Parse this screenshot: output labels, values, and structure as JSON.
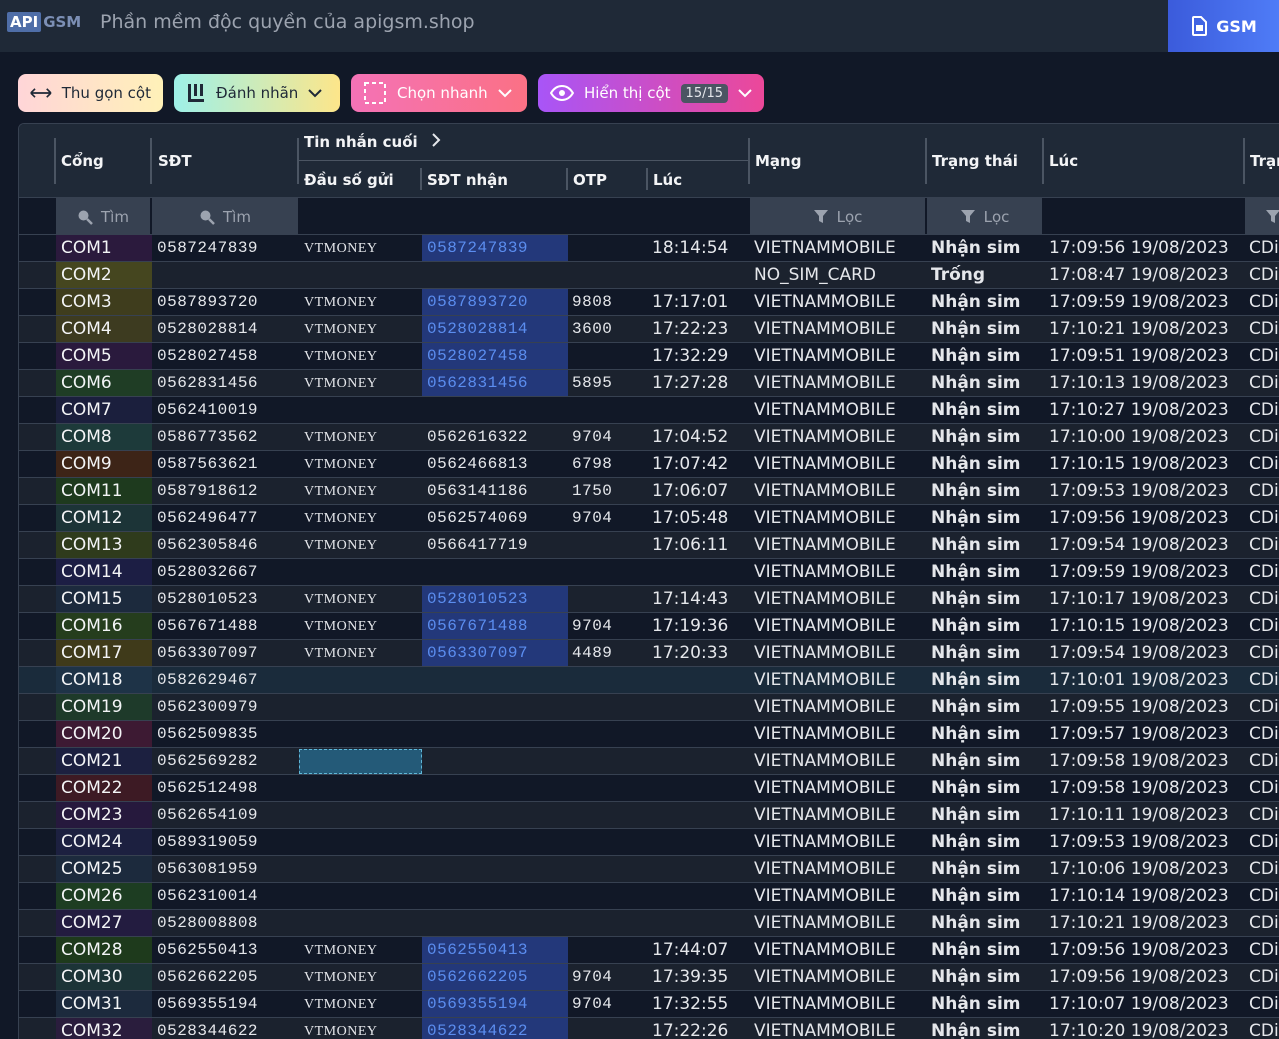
{
  "header": {
    "logo_api": "API",
    "logo_gsm": "GSM",
    "title": "Phần mềm độc quyền của apigsm.shop",
    "tab_label": "GSM"
  },
  "toolbar": {
    "collapse_label": "Thu gọn cột",
    "label_label": "Đánh nhãn",
    "quick_select_label": "Chọn nhanh",
    "show_columns_label": "Hiển thị cột",
    "show_columns_count": "15/15"
  },
  "columns": {
    "port": "Cổng",
    "sdt": "SĐT",
    "last_message": "Tin nhắn cuối",
    "sender": "Đầu số gửi",
    "receiver": "SĐT nhận",
    "otp": "OTP",
    "msg_time": "Lúc",
    "network": "Mạng",
    "status": "Trạng thái",
    "time": "Lúc",
    "station": "Trạm"
  },
  "filters": {
    "search_placeholder": "Tìm",
    "filter_placeholder": "Lọc"
  },
  "colors": {
    "highlight_bg": "#23387a",
    "highlight_text": "#5b8def",
    "accent_blue": "#3b5bdb"
  },
  "rows": [
    {
      "port": "COM1",
      "port_color": "#2b1a3d",
      "sdt": "0587247839",
      "sender": "VTMONEY",
      "receiver": "0587247839",
      "hl": true,
      "otp": "",
      "msg_time": "18:14:54",
      "network": "VIETNAMMOBILE",
      "status": "Nhận sim",
      "time": "17:09:56 19/08/2023",
      "station": "CDi"
    },
    {
      "port": "COM2",
      "port_color": "#45461f",
      "sdt": "",
      "sender": "",
      "receiver": "",
      "hl": false,
      "otp": "",
      "msg_time": "",
      "network": "NO_SIM_CARD",
      "status": "Trống",
      "time": "17:08:47 19/08/2023",
      "station": "CDi"
    },
    {
      "port": "COM3",
      "port_color": "#3f3d1d",
      "sdt": "0587893720",
      "sender": "VTMONEY",
      "receiver": "0587893720",
      "hl": true,
      "otp": "9808",
      "msg_time": "17:17:01",
      "network": "VIETNAMMOBILE",
      "status": "Nhận sim",
      "time": "17:09:59 19/08/2023",
      "station": "CDi"
    },
    {
      "port": "COM4",
      "port_color": "#3d3b20",
      "sdt": "0528028814",
      "sender": "VTMONEY",
      "receiver": "0528028814",
      "hl": true,
      "otp": "3600",
      "msg_time": "17:22:23",
      "network": "VIETNAMMOBILE",
      "status": "Nhận sim",
      "time": "17:10:21 19/08/2023",
      "station": "CDi"
    },
    {
      "port": "COM5",
      "port_color": "#2a1a3d",
      "sdt": "0528027458",
      "sender": "VTMONEY",
      "receiver": "0528027458",
      "hl": true,
      "otp": "",
      "msg_time": "17:32:29",
      "network": "VIETNAMMOBILE",
      "status": "Nhận sim",
      "time": "17:09:51 19/08/2023",
      "station": "CDi"
    },
    {
      "port": "COM6",
      "port_color": "#1f3d25",
      "sdt": "0562831456",
      "sender": "VTMONEY",
      "receiver": "0562831456",
      "hl": true,
      "otp": "5895",
      "msg_time": "17:27:28",
      "network": "VIETNAMMOBILE",
      "status": "Nhận sim",
      "time": "17:10:13 19/08/2023",
      "station": "CDi"
    },
    {
      "port": "COM7",
      "port_color": "#1b1f3d",
      "sdt": "0562410019",
      "sender": "",
      "receiver": "",
      "hl": false,
      "otp": "",
      "msg_time": "",
      "network": "VIETNAMMOBILE",
      "status": "Nhận sim",
      "time": "17:10:27 19/08/2023",
      "station": "CDi"
    },
    {
      "port": "COM8",
      "port_color": "#1d3a3a",
      "sdt": "0586773562",
      "sender": "VTMONEY",
      "receiver": "0562616322",
      "hl": false,
      "otp": "9704",
      "msg_time": "17:04:52",
      "network": "VIETNAMMOBILE",
      "status": "Nhận sim",
      "time": "17:10:00 19/08/2023",
      "station": "CDi"
    },
    {
      "port": "COM9",
      "port_color": "#3d2417",
      "sdt": "0587563621",
      "sender": "VTMONEY",
      "receiver": "0562466813",
      "hl": false,
      "otp": "6798",
      "msg_time": "17:07:42",
      "network": "VIETNAMMOBILE",
      "status": "Nhận sim",
      "time": "17:10:15 19/08/2023",
      "station": "CDi"
    },
    {
      "port": "COM11",
      "port_color": "#1e3a1e",
      "sdt": "0587918612",
      "sender": "VTMONEY",
      "receiver": "0563141186",
      "hl": false,
      "otp": "1750",
      "msg_time": "17:06:07",
      "network": "VIETNAMMOBILE",
      "status": "Nhận sim",
      "time": "17:09:53 19/08/2023",
      "station": "CDi"
    },
    {
      "port": "COM12",
      "port_color": "#1c3437",
      "sdt": "0562496477",
      "sender": "VTMONEY",
      "receiver": "0562574069",
      "hl": false,
      "otp": "9704",
      "msg_time": "17:05:48",
      "network": "VIETNAMMOBILE",
      "status": "Nhận sim",
      "time": "17:09:56 19/08/2023",
      "station": "CDi"
    },
    {
      "port": "COM13",
      "port_color": "#2f3b1c",
      "sdt": "0562305846",
      "sender": "VTMONEY",
      "receiver": "0566417719",
      "hl": false,
      "otp": "",
      "msg_time": "17:06:11",
      "network": "VIETNAMMOBILE",
      "status": "Nhận sim",
      "time": "17:09:54 19/08/2023",
      "station": "CDi"
    },
    {
      "port": "COM14",
      "port_color": "#1c1e44",
      "sdt": "0528032667",
      "sender": "",
      "receiver": "",
      "hl": false,
      "otp": "",
      "msg_time": "",
      "network": "VIETNAMMOBILE",
      "status": "Nhận sim",
      "time": "17:09:59 19/08/2023",
      "station": "CDi"
    },
    {
      "port": "COM15",
      "port_color": "#1c2a3d",
      "sdt": "0528010523",
      "sender": "VTMONEY",
      "receiver": "0528010523",
      "hl": true,
      "otp": "",
      "msg_time": "17:14:43",
      "network": "VIETNAMMOBILE",
      "status": "Nhận sim",
      "time": "17:10:17 19/08/2023",
      "station": "CDi"
    },
    {
      "port": "COM16",
      "port_color": "#253d1d",
      "sdt": "0567671488",
      "sender": "VTMONEY",
      "receiver": "0567671488",
      "hl": true,
      "otp": "9704",
      "msg_time": "17:19:36",
      "network": "VIETNAMMOBILE",
      "status": "Nhận sim",
      "time": "17:10:15 19/08/2023",
      "station": "CDi"
    },
    {
      "port": "COM17",
      "port_color": "#3f3a1a",
      "sdt": "0563307097",
      "sender": "VTMONEY",
      "receiver": "0563307097",
      "hl": true,
      "otp": "4489",
      "msg_time": "17:20:33",
      "network": "VIETNAMMOBILE",
      "status": "Nhận sim",
      "time": "17:09:54 19/08/2023",
      "station": "CDi"
    },
    {
      "port": "COM18",
      "port_color": "#1e3347",
      "sdt": "0582629467",
      "sender": "",
      "receiver": "",
      "hl": false,
      "otp": "",
      "msg_time": "",
      "network": "VIETNAMMOBILE",
      "status": "Nhận sim",
      "time": "17:10:01 19/08/2023",
      "station": "CDi"
    },
    {
      "port": "COM19",
      "port_color": "#1e3a2a",
      "sdt": "0562300979",
      "sender": "",
      "receiver": "",
      "hl": false,
      "otp": "",
      "msg_time": "",
      "network": "VIETNAMMOBILE",
      "status": "Nhận sim",
      "time": "17:09:55 19/08/2023",
      "station": "CDi"
    },
    {
      "port": "COM20",
      "port_color": "#3d1a33",
      "sdt": "0562509835",
      "sender": "",
      "receiver": "",
      "hl": false,
      "otp": "",
      "msg_time": "",
      "network": "VIETNAMMOBILE",
      "status": "Nhận sim",
      "time": "17:09:57 19/08/2023",
      "station": "CDi"
    },
    {
      "port": "COM21",
      "port_color": "#1c2040",
      "sdt": "0562569282",
      "sender": "",
      "receiver": "",
      "hl": false,
      "otp": "",
      "msg_time": "",
      "network": "VIETNAMMOBILE",
      "status": "Nhận sim",
      "time": "17:09:58 19/08/2023",
      "station": "CDi",
      "selected": true
    },
    {
      "port": "COM22",
      "port_color": "#3d1a24",
      "sdt": "0562512498",
      "sender": "",
      "receiver": "",
      "hl": false,
      "otp": "",
      "msg_time": "",
      "network": "VIETNAMMOBILE",
      "status": "Nhận sim",
      "time": "17:09:58 19/08/2023",
      "station": "CDi"
    },
    {
      "port": "COM23",
      "port_color": "#26193d",
      "sdt": "0562654109",
      "sender": "",
      "receiver": "",
      "hl": false,
      "otp": "",
      "msg_time": "",
      "network": "VIETNAMMOBILE",
      "status": "Nhận sim",
      "time": "17:10:11 19/08/2023",
      "station": "CDi"
    },
    {
      "port": "COM24",
      "port_color": "#1c2040",
      "sdt": "0589319059",
      "sender": "",
      "receiver": "",
      "hl": false,
      "otp": "",
      "msg_time": "",
      "network": "VIETNAMMOBILE",
      "status": "Nhận sim",
      "time": "17:09:53 19/08/2023",
      "station": "CDi"
    },
    {
      "port": "COM25",
      "port_color": "#1c2a3d",
      "sdt": "0563081959",
      "sender": "",
      "receiver": "",
      "hl": false,
      "otp": "",
      "msg_time": "",
      "network": "VIETNAMMOBILE",
      "status": "Nhận sim",
      "time": "17:10:06 19/08/2023",
      "station": "CDi"
    },
    {
      "port": "COM26",
      "port_color": "#1d3d22",
      "sdt": "0562310014",
      "sender": "",
      "receiver": "",
      "hl": false,
      "otp": "",
      "msg_time": "",
      "network": "VIETNAMMOBILE",
      "status": "Nhận sim",
      "time": "17:10:14 19/08/2023",
      "station": "CDi"
    },
    {
      "port": "COM27",
      "port_color": "#231c40",
      "sdt": "0528008808",
      "sender": "",
      "receiver": "",
      "hl": false,
      "otp": "",
      "msg_time": "",
      "network": "VIETNAMMOBILE",
      "status": "Nhận sim",
      "time": "17:10:21 19/08/2023",
      "station": "CDi"
    },
    {
      "port": "COM28",
      "port_color": "#1e3a1c",
      "sdt": "0562550413",
      "sender": "VTMONEY",
      "receiver": "0562550413",
      "hl": true,
      "otp": "",
      "msg_time": "17:44:07",
      "network": "VIETNAMMOBILE",
      "status": "Nhận sim",
      "time": "17:09:56 19/08/2023",
      "station": "CDi"
    },
    {
      "port": "COM30",
      "port_color": "#1c3437",
      "sdt": "0562662205",
      "sender": "VTMONEY",
      "receiver": "0562662205",
      "hl": true,
      "otp": "9704",
      "msg_time": "17:39:35",
      "network": "VIETNAMMOBILE",
      "status": "Nhận sim",
      "time": "17:09:56 19/08/2023",
      "station": "CDi"
    },
    {
      "port": "COM31",
      "port_color": "#1c2a3d",
      "sdt": "0569355194",
      "sender": "VTMONEY",
      "receiver": "0569355194",
      "hl": true,
      "otp": "9704",
      "msg_time": "17:32:55",
      "network": "VIETNAMMOBILE",
      "status": "Nhận sim",
      "time": "17:10:07 19/08/2023",
      "station": "CDi"
    },
    {
      "port": "COM32",
      "port_color": "#2a1d3d",
      "sdt": "0528344622",
      "sender": "VTMONEY",
      "receiver": "0528344622",
      "hl": true,
      "otp": "",
      "msg_time": "17:22:26",
      "network": "VIETNAMMOBILE",
      "status": "Nhận sim",
      "time": "17:10:20 19/08/2023",
      "station": "CDi"
    }
  ]
}
